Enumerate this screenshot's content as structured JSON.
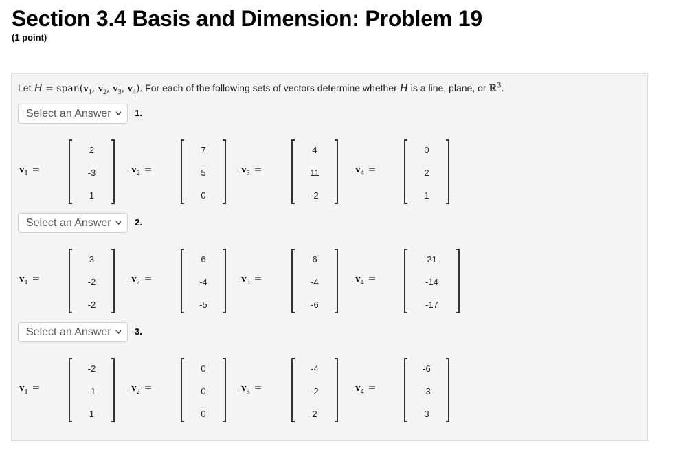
{
  "header": {
    "title": "Section 3.4 Basis and Dimension: Problem 19",
    "points": "(1 point)"
  },
  "intro": {
    "let": "Let ",
    "H": "H",
    "eq_span": " = span(",
    "v": "v",
    "subs": [
      "1",
      "2",
      "3",
      "4"
    ],
    "sep": ", ",
    "close": ")",
    "text": ". For each of the following sets of vectors determine whether ",
    "text2": " is a line, plane, or ",
    "R": "ℝ",
    "R_exp": "3",
    "end": "."
  },
  "problems": [
    {
      "number": "1.",
      "select": {
        "value": "Select an Answer",
        "options": [
          "Select an Answer"
        ]
      },
      "vectors": [
        {
          "name": "v",
          "sub": "1",
          "entries": [
            "2",
            "-3",
            "1"
          ]
        },
        {
          "name": "v",
          "sub": "2",
          "entries": [
            "7",
            "5",
            "0"
          ]
        },
        {
          "name": "v",
          "sub": "3",
          "entries": [
            "4",
            "11",
            "-2"
          ]
        },
        {
          "name": "v",
          "sub": "4",
          "entries": [
            "0",
            "2",
            "1"
          ]
        }
      ]
    },
    {
      "number": "2.",
      "select": {
        "value": "Select an Answer",
        "options": [
          "Select an Answer"
        ]
      },
      "vectors": [
        {
          "name": "v",
          "sub": "1",
          "entries": [
            "3",
            "-2",
            "-2"
          ]
        },
        {
          "name": "v",
          "sub": "2",
          "entries": [
            "6",
            "-4",
            "-5"
          ]
        },
        {
          "name": "v",
          "sub": "3",
          "entries": [
            "6",
            "-4",
            "-6"
          ]
        },
        {
          "name": "v",
          "sub": "4",
          "entries": [
            "21",
            "-14",
            "-17"
          ]
        }
      ]
    },
    {
      "number": "3.",
      "select": {
        "value": "Select an Answer",
        "options": [
          "Select an Answer"
        ]
      },
      "vectors": [
        {
          "name": "v",
          "sub": "1",
          "entries": [
            "-2",
            "-1",
            "1"
          ]
        },
        {
          "name": "v",
          "sub": "2",
          "entries": [
            "0",
            "0",
            "0"
          ]
        },
        {
          "name": "v",
          "sub": "3",
          "entries": [
            "-4",
            "-2",
            "2"
          ]
        },
        {
          "name": "v",
          "sub": "4",
          "entries": [
            "-6",
            "-3",
            "3"
          ]
        }
      ]
    }
  ],
  "labels": {
    "equals": "=",
    "comma": ",",
    "chevron": "⌄"
  }
}
